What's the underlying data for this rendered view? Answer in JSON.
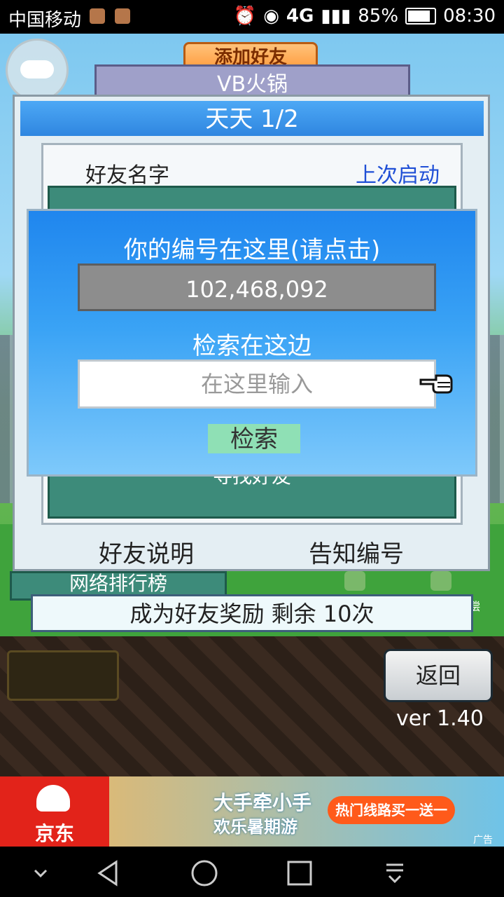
{
  "status_bar": {
    "carrier": "中国移动",
    "network": "4G",
    "battery": "85%",
    "time": "08:30"
  },
  "game": {
    "add_friend_button": "添加好友",
    "team_name": "VB火锅",
    "friends_dialog": {
      "title": "天天 1/2",
      "col_friend_name": "好友名字",
      "col_last_launch": "上次启动",
      "find_friend": "寻找好友",
      "friend_help": "好友说明",
      "notify_id": "告知编号"
    },
    "ranking_label": "网络排行榜",
    "search_popup": {
      "your_id_label": "你的编号在这里(请点击)",
      "id_value": "102,468,092",
      "search_label": "检索在这边",
      "search_placeholder": "在这里输入",
      "search_button": "检索"
    },
    "reward_bar": "成为好友奖励 剩余 10次",
    "back_button": "返回",
    "version": "ver 1.40",
    "side_tag": "偿"
  },
  "ad": {
    "brand": "京东",
    "headline": "大手牵小手",
    "subline": "欢乐暑期游",
    "cta": "热门线路买一送一",
    "tag": "广告"
  },
  "icons": [
    "gamepad-icon",
    "pointer-hand-icon",
    "back-triangle-icon",
    "home-circle-icon",
    "recents-square-icon",
    "notification-pull-icon",
    "chevron-down-icon"
  ]
}
